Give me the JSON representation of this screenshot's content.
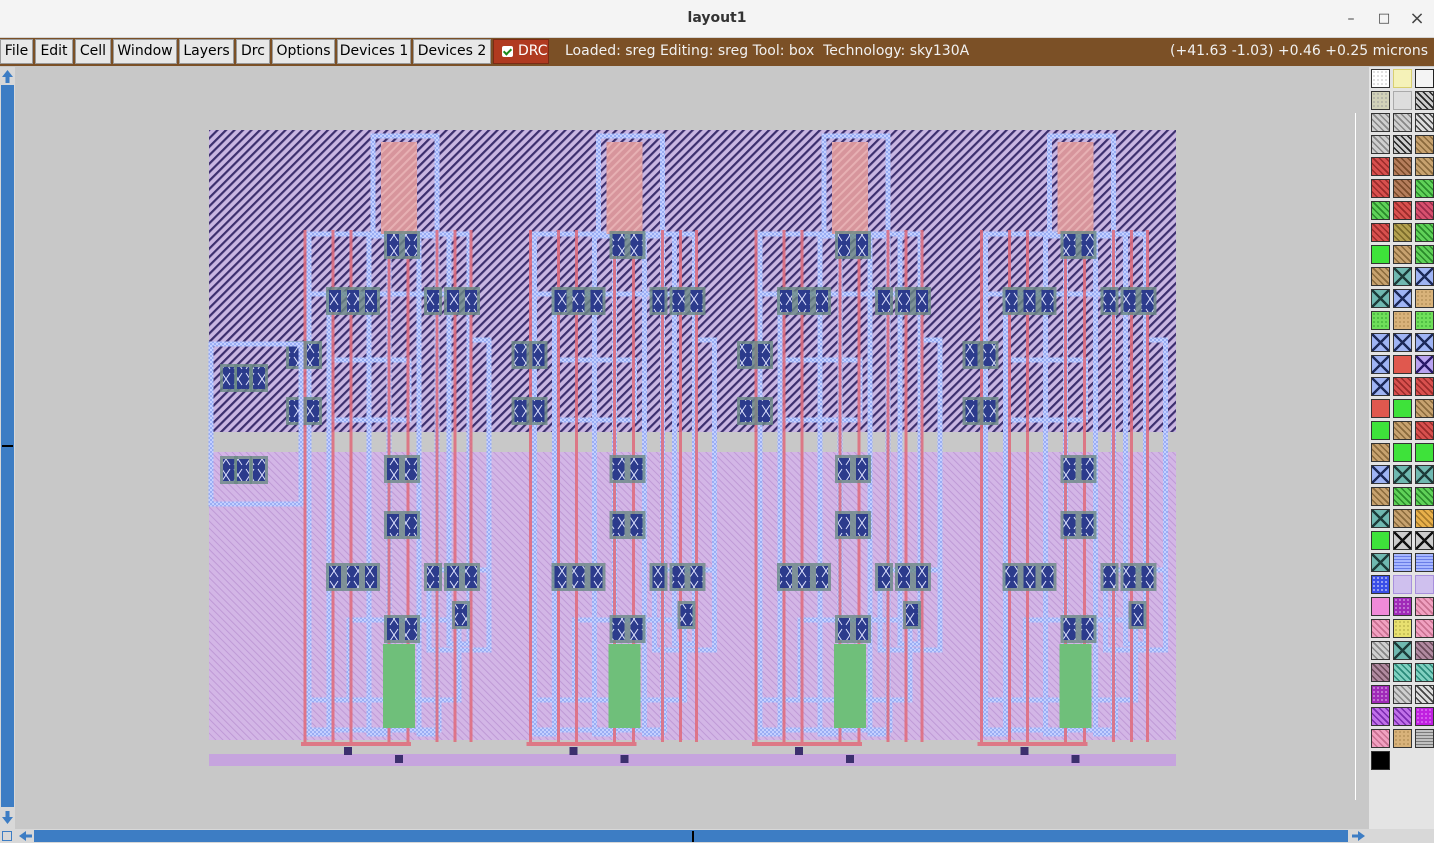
{
  "window": {
    "title": "layout1",
    "minimize": "–",
    "maximize": "□",
    "close": "×"
  },
  "menu": {
    "items": [
      "File",
      "Edit",
      "Cell",
      "Window",
      "Layers",
      "Drc",
      "Options",
      "Devices 1",
      "Devices 2"
    ]
  },
  "drc": {
    "label": "DRC",
    "checked": true
  },
  "status": {
    "text": "Loaded: sreg Editing: sreg Tool: box  Technology: sky130A"
  },
  "coords": {
    "text": "(+41.63 -1.03) +0.46 +0.25 microns"
  },
  "colors": {
    "menubar": "#7b5026",
    "drc": "#b03a20",
    "scroll": "#3d7dc4",
    "nwell": "#5b4c8c",
    "pwell": "#c9a8de",
    "poly": "#e06a7a",
    "metal1": "#a7b7ff",
    "contact": "#6a8a84",
    "diff": "#6fbf7a"
  },
  "layout": {
    "cell": "sreg",
    "repeats": 4
  },
  "palette": {
    "swatches": [
      "grid-white",
      "yellow-outline",
      "black-outline",
      "gray-dots",
      "gray-light",
      "black-diag",
      "gray-diag",
      "gray-diag",
      "gray-diag2",
      "gray-diag",
      "black-diag",
      "tan-diag",
      "red-diag",
      "brown-diag",
      "tan-diag",
      "red-diag",
      "brown-diag",
      "green-diag",
      "green-diag",
      "red-diag",
      "magenta-diag",
      "red-diag",
      "olive-diag",
      "green-diag",
      "green-solid",
      "tan-diag",
      "green-diag",
      "tan-diag",
      "teal-x",
      "blue-x",
      "teal-x",
      "blue-x",
      "tan-dots",
      "green-dots",
      "tan-dots",
      "green-dots",
      "blue-x",
      "blue-x",
      "blue-x",
      "blue-x",
      "red-solid",
      "purple-x",
      "blue-x",
      "red-diag",
      "red-diag",
      "red-solid",
      "green-solid",
      "tan-diag",
      "green-solid",
      "tan-diag",
      "red-diag",
      "tan-diag",
      "green-solid",
      "green-solid",
      "blue-x",
      "teal-x",
      "teal-x",
      "tan-diag",
      "green-diag",
      "green-diag",
      "teal-x",
      "tan-diag",
      "orange-diag",
      "green-solid",
      "black-x",
      "black-x",
      "teal-x",
      "blue-stripe",
      "blue-stripe",
      "blue-check",
      "lavender",
      "lavender",
      "pink-solid",
      "purple-dots",
      "pink-diag",
      "pink-diag",
      "yellow-dots",
      "pink-diag",
      "gray-diag",
      "teal-x",
      "mauve-diag",
      "mauve-diag",
      "teal-diag",
      "teal-diag",
      "purple-dots",
      "gray-diag",
      "gray-diag2",
      "purple-diag",
      "purple-diag",
      "magenta-dots",
      "pink-diag",
      "tan-dots",
      "gray-stripe",
      "black-solid"
    ]
  }
}
